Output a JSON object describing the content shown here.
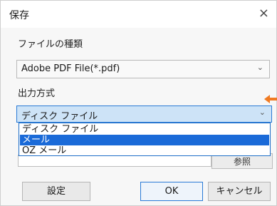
{
  "dialog": {
    "title": "保存",
    "close_label": "×"
  },
  "file_type": {
    "label": "ファイルの種類",
    "value": "Adobe PDF File(*.pdf)"
  },
  "output_method": {
    "label": "出力方式",
    "value": "ディスク ファイル",
    "options": [
      {
        "label": "ディスク ファイル",
        "selected": false
      },
      {
        "label": "メール",
        "selected": true
      },
      {
        "label": "OZ メール",
        "selected": false
      }
    ]
  },
  "browse_button_label": "参照",
  "buttons": {
    "settings": "設定",
    "ok": "OK",
    "cancel": "キャンセル"
  },
  "colors": {
    "accent": "#1a6ad8",
    "annotation_arrow": "#f07a22"
  }
}
